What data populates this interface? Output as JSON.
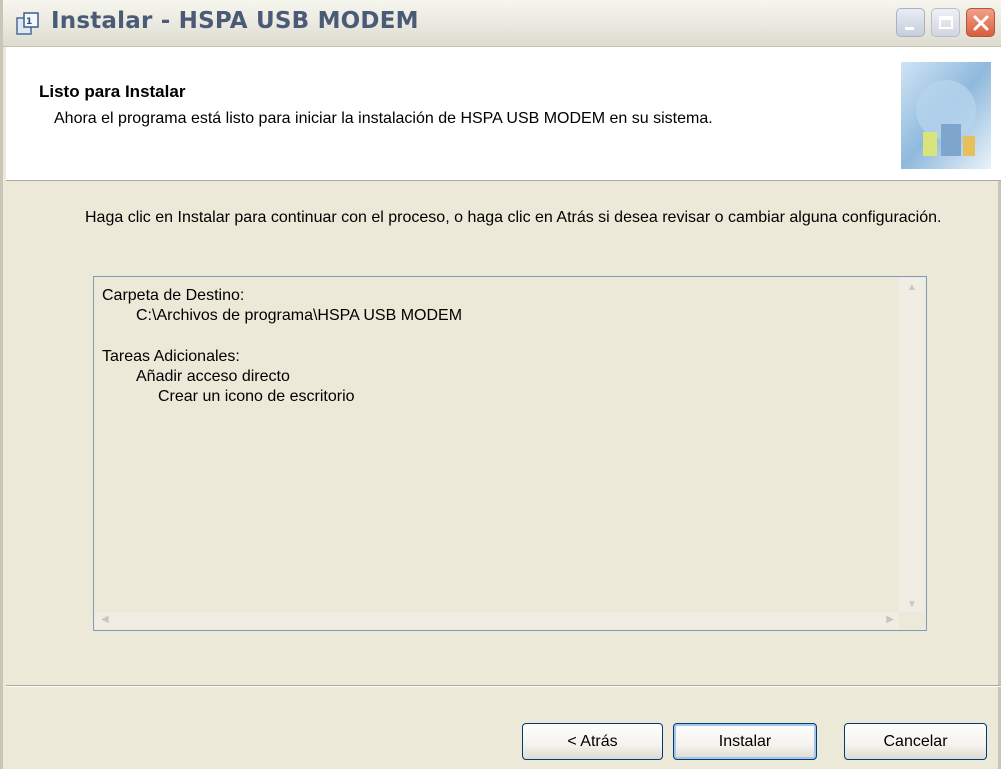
{
  "window": {
    "title": "Instalar - HSPA USB MODEM",
    "controls": [
      "minimize-icon",
      "maximize-icon",
      "close-icon"
    ]
  },
  "header": {
    "title": "Listo para Instalar",
    "description": "Ahora el programa está listo para iniciar la instalación de HSPA USB MODEM en su sistema."
  },
  "main": {
    "intro": "Haga clic en Instalar para continuar con el proceso, o haga clic en Atrás si desea revisar o cambiar alguna configuración.",
    "memo": {
      "destination_label": "Carpeta de Destino:",
      "destination_path": "C:\\Archivos de programa\\HSPA USB MODEM",
      "tasks_label": "Tareas Adicionales:",
      "task_group": "Añadir acceso directo",
      "task_item": "Crear un icono de escritorio"
    }
  },
  "buttons": {
    "back": "< Atrás",
    "install": "Instalar",
    "cancel": "Cancelar"
  },
  "colors": {
    "titlebar_text": "#4b5a77",
    "dialog_face": "#ece9d8",
    "button_border": "#003c74"
  }
}
